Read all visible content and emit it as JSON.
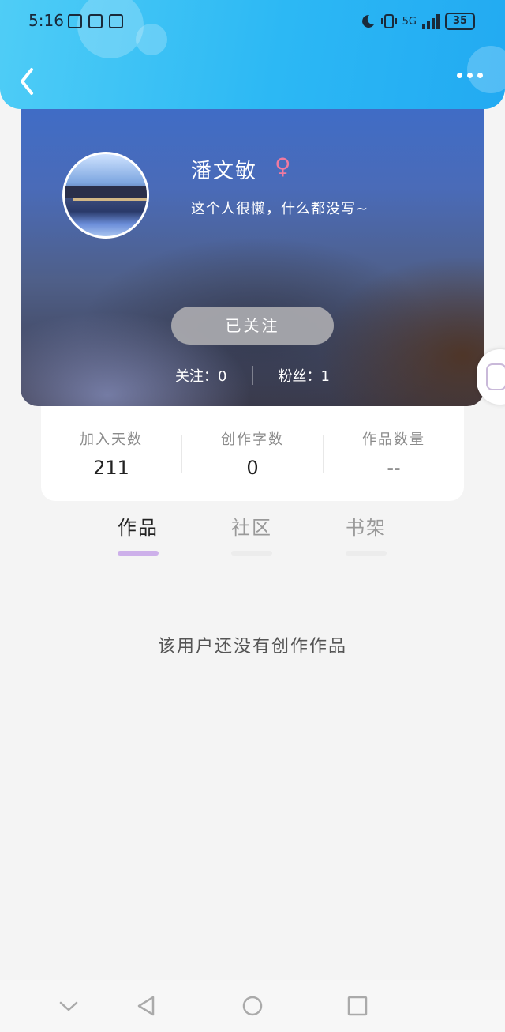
{
  "status_bar": {
    "time": "5:16",
    "network": "5G",
    "battery": "35"
  },
  "profile": {
    "name": "潘文敏",
    "gender_symbol": "♀",
    "bio": "这个人很懒，什么都没写~",
    "follow_button": "已关注",
    "following": "关注：0",
    "followers": "粉丝：1"
  },
  "stats": [
    {
      "label": "加入天数",
      "value": "211"
    },
    {
      "label": "创作字数",
      "value": "0"
    },
    {
      "label": "作品数量",
      "value": "--"
    }
  ],
  "tabs": [
    {
      "label": "作品",
      "active": true
    },
    {
      "label": "社区",
      "active": false
    },
    {
      "label": "书架",
      "active": false
    }
  ],
  "empty_message": "该用户还没有创作作品",
  "colors": {
    "header": "#2cb8f4",
    "accent": "#cdb0ea",
    "gender": "#f07aa0"
  }
}
